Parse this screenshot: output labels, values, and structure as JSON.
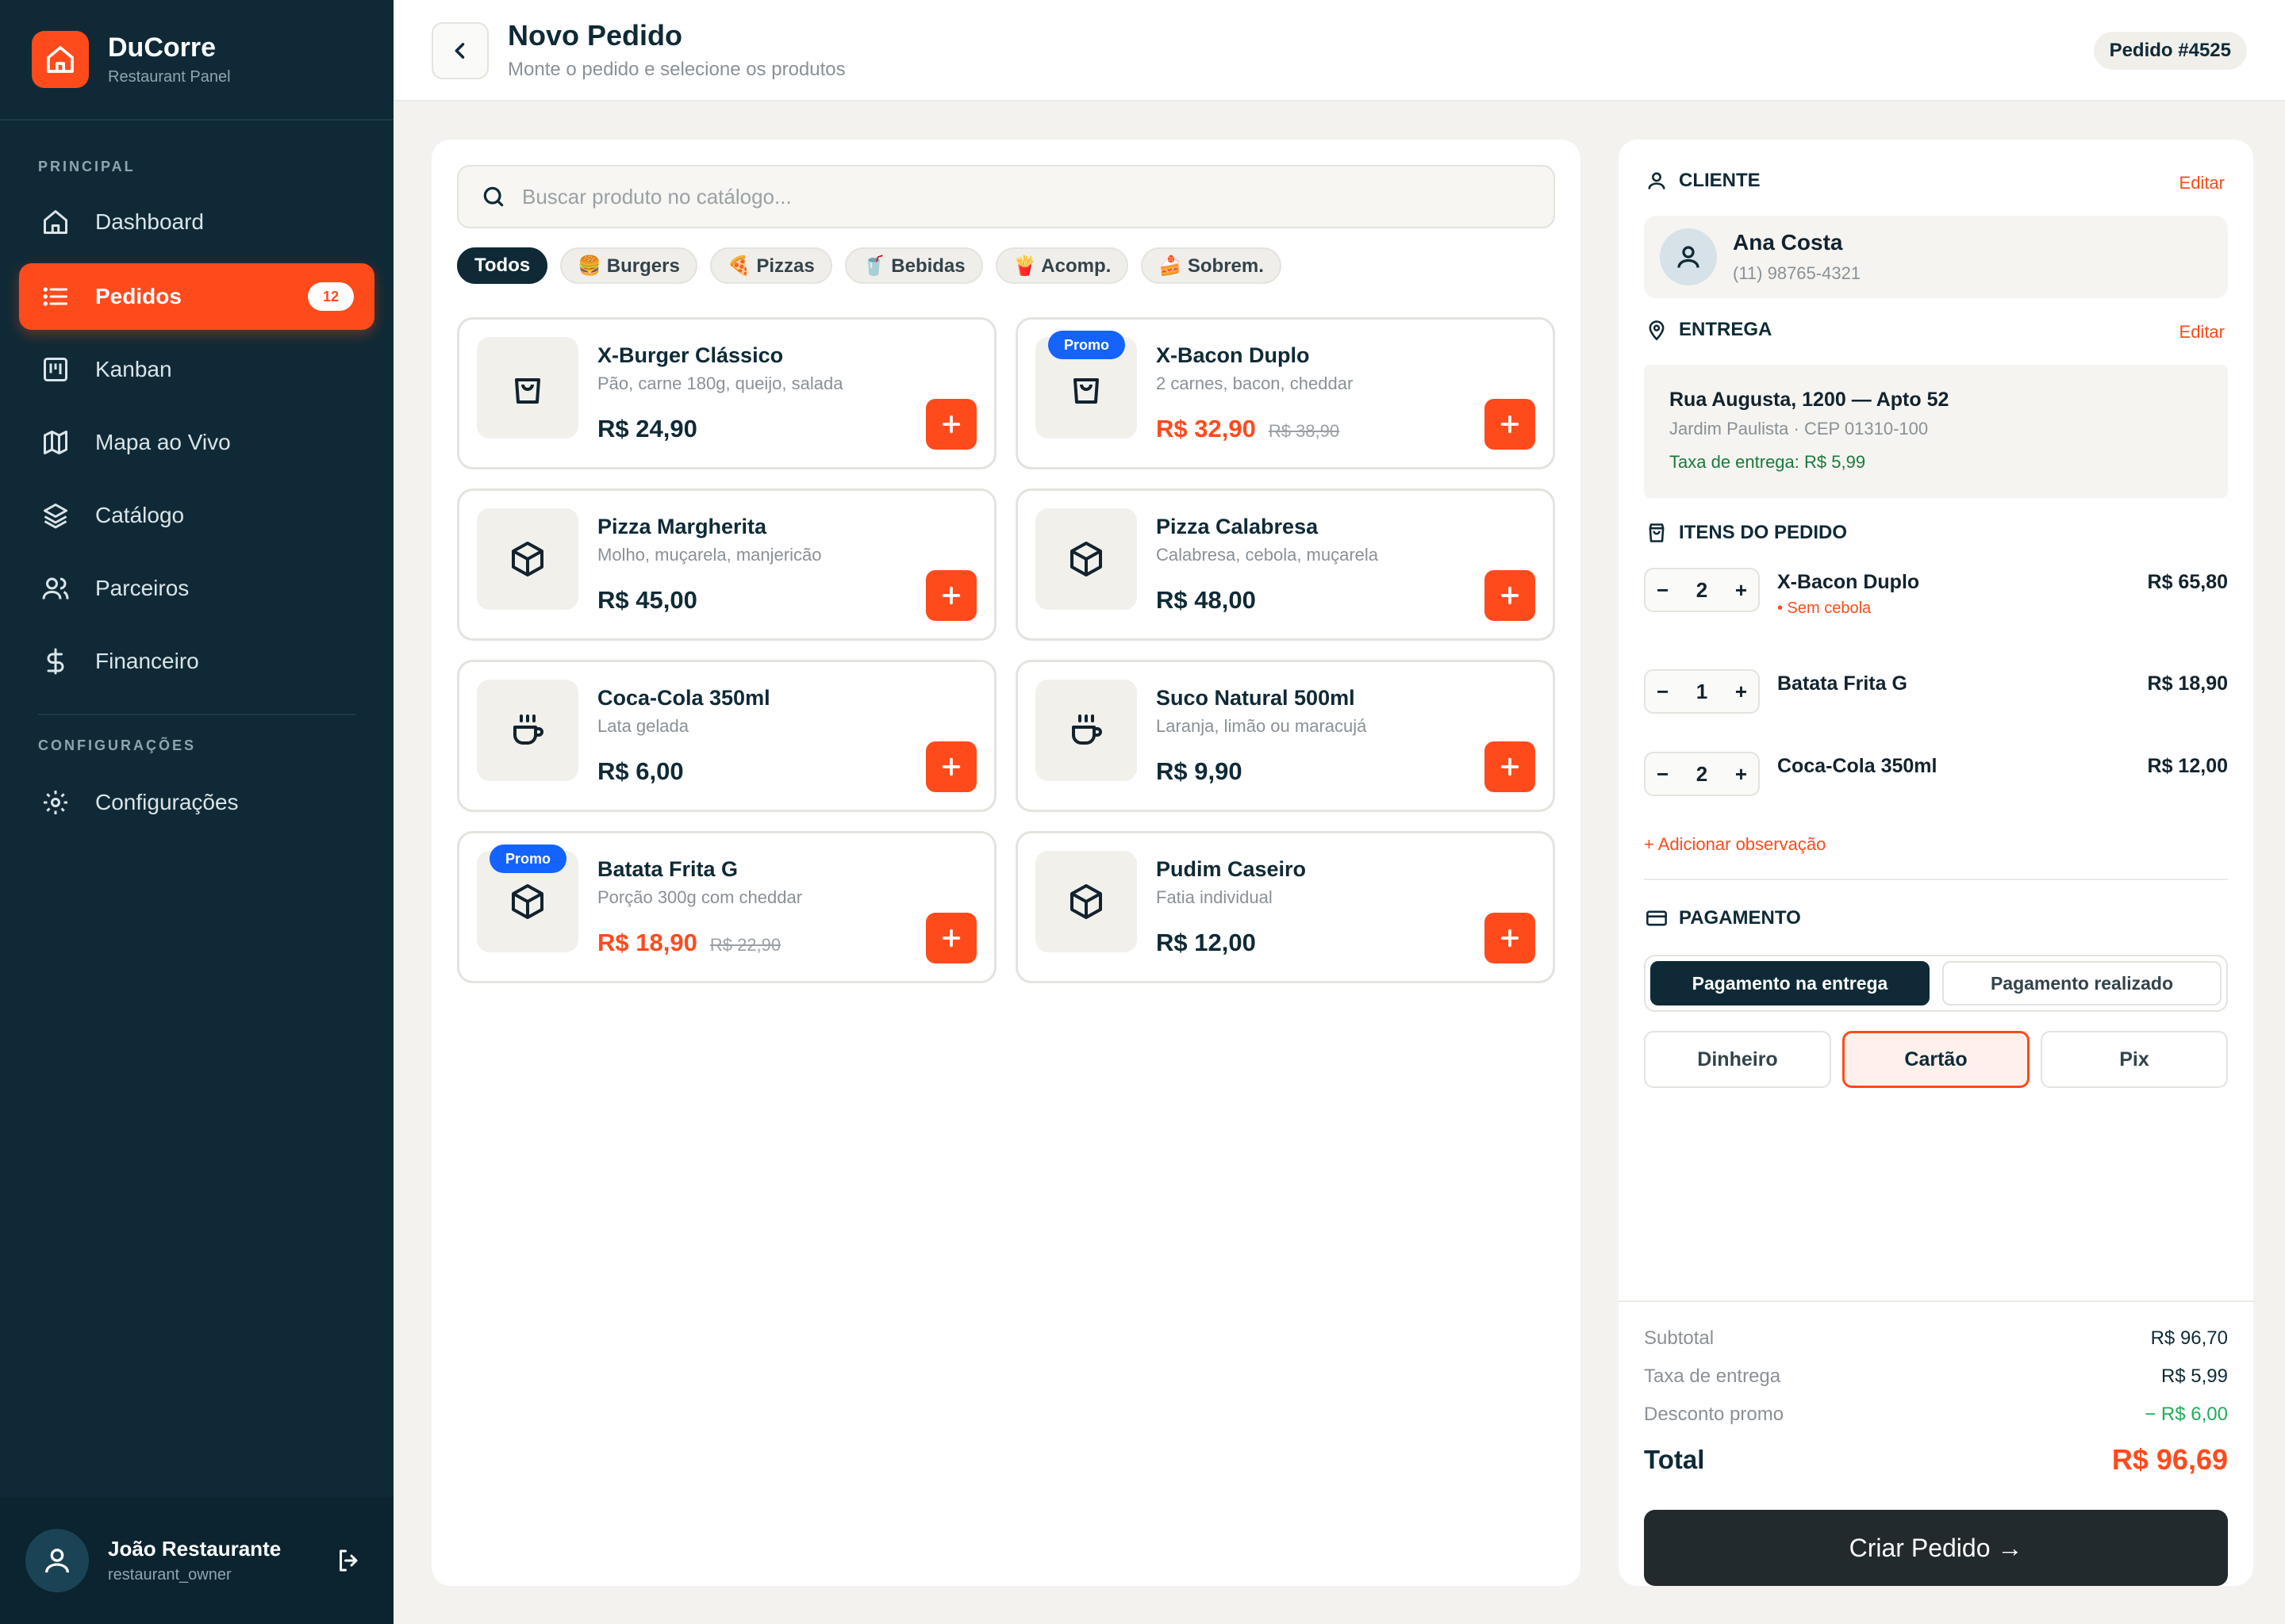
{
  "brand": {
    "name": "DuCorre",
    "subtitle": "Restaurant Panel"
  },
  "sidebar": {
    "section_main": "PRINCIPAL",
    "section_config": "CONFIGURAÇÕES",
    "items": [
      {
        "label": "Dashboard",
        "icon": "home-icon"
      },
      {
        "label": "Pedidos",
        "icon": "list-icon",
        "badge": "12",
        "active": true
      },
      {
        "label": "Kanban",
        "icon": "kanban-icon"
      },
      {
        "label": "Mapa ao Vivo",
        "icon": "map-icon"
      },
      {
        "label": "Catálogo",
        "icon": "layers-icon"
      },
      {
        "label": "Parceiros",
        "icon": "users-icon"
      },
      {
        "label": "Financeiro",
        "icon": "dollar-icon"
      }
    ],
    "config_items": [
      {
        "label": "Configurações",
        "icon": "gear-icon"
      }
    ],
    "user": {
      "name": "João Restaurante",
      "role": "restaurant_owner"
    }
  },
  "header": {
    "title": "Novo Pedido",
    "subtitle": "Monte o pedido e selecione os produtos",
    "order_badge": "Pedido #4525"
  },
  "catalog": {
    "search_placeholder": "Buscar produto no catálogo...",
    "chips": [
      "Todos",
      "🍔 Burgers",
      "🍕 Pizzas",
      "🥤 Bebidas",
      "🍟 Acomp.",
      "🍰 Sobrem."
    ],
    "promo_label": "Promo",
    "products": [
      {
        "name": "X-Burger Clássico",
        "desc": "Pão, carne 180g, queijo, salada",
        "price": "R$ 24,90",
        "icon": "bag-icon"
      },
      {
        "name": "X-Bacon Duplo",
        "desc": "2 carnes, bacon, cheddar",
        "price": "R$ 32,90",
        "old_price": "R$ 38,90",
        "promo": true,
        "icon": "bag-icon"
      },
      {
        "name": "Pizza Margherita",
        "desc": "Molho, muçarela, manjericão",
        "price": "R$ 45,00",
        "icon": "box-icon"
      },
      {
        "name": "Pizza Calabresa",
        "desc": "Calabresa, cebola, muçarela",
        "price": "R$ 48,00",
        "icon": "box-icon"
      },
      {
        "name": "Coca-Cola 350ml",
        "desc": "Lata gelada",
        "price": "R$ 6,00",
        "icon": "coffee-icon"
      },
      {
        "name": "Suco Natural 500ml",
        "desc": "Laranja, limão ou maracujá",
        "price": "R$ 9,90",
        "icon": "coffee-icon"
      },
      {
        "name": "Batata Frita G",
        "desc": "Porção 300g com cheddar",
        "price": "R$ 18,90",
        "old_price": "R$ 22,90",
        "promo": true,
        "icon": "box-icon"
      },
      {
        "name": "Pudim Caseiro",
        "desc": "Fatia individual",
        "price": "R$ 12,00",
        "icon": "box-icon"
      }
    ]
  },
  "order": {
    "client_title": "CLIENTE",
    "edit": "Editar",
    "client": {
      "name": "Ana Costa",
      "phone": "(11) 98765-4321"
    },
    "delivery_title": "ENTREGA",
    "address": {
      "line1": "Rua Augusta, 1200 — Apto 52",
      "line2": "Jardim Paulista · CEP 01310-100",
      "fee": "Taxa de entrega: R$ 5,99"
    },
    "items_title": "ITENS DO PEDIDO",
    "items": [
      {
        "qty": "2",
        "name": "X-Bacon Duplo",
        "note": "• Sem cebola",
        "price": "R$ 65,80"
      },
      {
        "qty": "1",
        "name": "Batata Frita G",
        "price": "R$ 18,90"
      },
      {
        "qty": "2",
        "name": "Coca-Cola 350ml",
        "price": "R$ 12,00"
      }
    ],
    "add_note": "+ Adicionar observação",
    "payment_title": "PAGAMENTO",
    "payment_modes": [
      "Pagamento na entrega",
      "Pagamento realizado"
    ],
    "payment_methods": [
      "Dinheiro",
      "Cartão",
      "Pix"
    ],
    "summary": {
      "subtotal_label": "Subtotal",
      "subtotal": "R$ 96,70",
      "fee_label": "Taxa de entrega",
      "fee": "R$ 5,99",
      "discount_label": "Desconto promo",
      "discount": "− R$ 6,00",
      "total_label": "Total",
      "total": "R$ 96,69"
    },
    "create_button": "Criar Pedido →"
  },
  "colors": {
    "accent": "#ff4a1c",
    "sidebar": "#0f2a36",
    "promo": "#1463ff",
    "success": "#1fae57"
  }
}
